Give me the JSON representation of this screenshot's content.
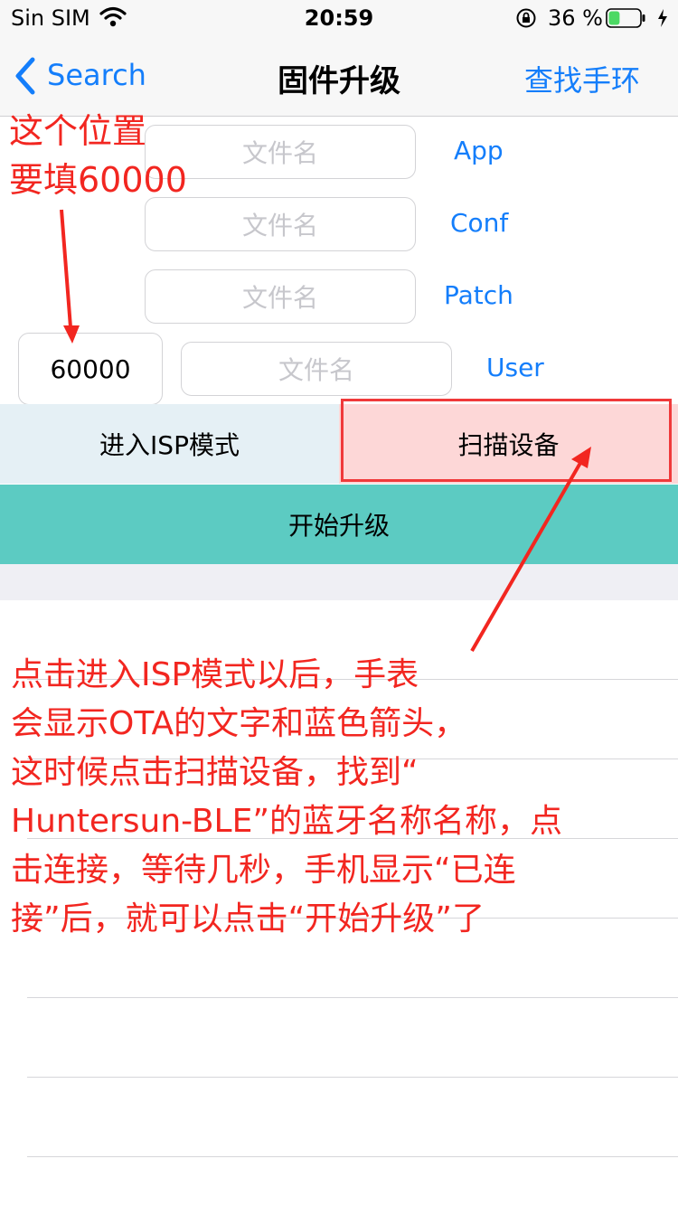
{
  "status_bar": {
    "carrier": "Sin SIM",
    "time": "20:59",
    "battery_percent": "36 %",
    "battery_level": 0.36,
    "icons": [
      "wifi-icon",
      "orientation-lock-icon",
      "battery-icon",
      "charging-bolt-icon"
    ]
  },
  "nav": {
    "back_label": "Search",
    "title": "固件升级",
    "right_action": "查找手环"
  },
  "files": {
    "placeholder": "文件名",
    "rows": [
      {
        "label": "App"
      },
      {
        "label": "Conf"
      },
      {
        "label": "Patch"
      },
      {
        "label": "User"
      }
    ],
    "user_value": "60000"
  },
  "buttons": {
    "isp_mode": "进入ISP模式",
    "scan_device": "扫描设备",
    "start_upgrade": "开始升级"
  },
  "annotations": {
    "top_line1": "这个位置",
    "top_line2": "要填60000",
    "bottom_lines": [
      "点击进入ISP模式以后，手表",
      "会显示OTA的文字和蓝色箭头，",
      "这时候点击扫描设备，找到“",
      "Huntersun-BLE”的蓝牙名称名称，点",
      "击连接，等待几秒，手机显示“已连",
      "接”后，就可以点击“开始升级”了"
    ],
    "color": "#f22620"
  },
  "colors": {
    "accent": "#147efb",
    "isp_bg": "#e5f0f5",
    "scan_bg": "#fdd7d7",
    "upgrade_bg": "#5ccbc2"
  }
}
